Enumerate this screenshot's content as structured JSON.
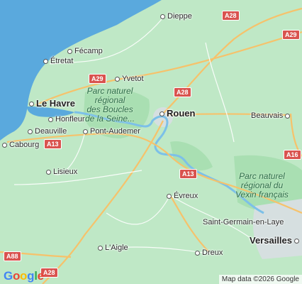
{
  "cities": [
    {
      "id": "dieppe",
      "name": "Dieppe",
      "dot": true
    },
    {
      "id": "fecamp",
      "name": "Fécamp",
      "dot": true
    },
    {
      "id": "etretat",
      "name": "Étretat",
      "dot": true
    },
    {
      "id": "yvetot",
      "name": "Yvetot",
      "dot": true
    },
    {
      "id": "le-havre",
      "name": "Le Havre",
      "dot": true,
      "major": true
    },
    {
      "id": "honfleur",
      "name": "Honfleur",
      "dot": true
    },
    {
      "id": "deauville",
      "name": "Deauville",
      "dot": true
    },
    {
      "id": "pont-audemer",
      "name": "Pont-Audemer",
      "dot": true
    },
    {
      "id": "cabourg",
      "name": "Cabourg",
      "dot": true
    },
    {
      "id": "lisieux",
      "name": "Lisieux",
      "dot": true
    },
    {
      "id": "rouen",
      "name": "Rouen",
      "dot": true,
      "major": true
    },
    {
      "id": "beauvais",
      "name": "Beauvais",
      "dot": true
    },
    {
      "id": "evreux",
      "name": "Évreux",
      "dot": true
    },
    {
      "id": "saint-germain",
      "name": "Saint-Germain-en-Laye",
      "dot": false
    },
    {
      "id": "versailles",
      "name": "Versailles",
      "dot": true,
      "major": true
    },
    {
      "id": "laigle",
      "name": "L'Aigle",
      "dot": true
    },
    {
      "id": "dreux",
      "name": "Dreux",
      "dot": true
    }
  ],
  "parks": [
    {
      "id": "boucles-seine",
      "lines": [
        "Parc naturel",
        "régional",
        "des Boucles",
        "de la Seine..."
      ]
    },
    {
      "id": "vexin",
      "lines": [
        "Parc naturel",
        "régional du",
        "Vexin français"
      ]
    }
  ],
  "road_shields": [
    "A28",
    "A29",
    "A29",
    "A28",
    "A13",
    "A13",
    "A16",
    "A88",
    "A28"
  ],
  "logo": "Google",
  "attribution": "Map data ©2026 Google",
  "colors": {
    "land": "#bfe8c6",
    "sea": "#5aa9dd",
    "road_major": "#f6c26b",
    "road_minor": "#ffffff",
    "river": "#7cc0e8",
    "shield": "#d9534f"
  }
}
